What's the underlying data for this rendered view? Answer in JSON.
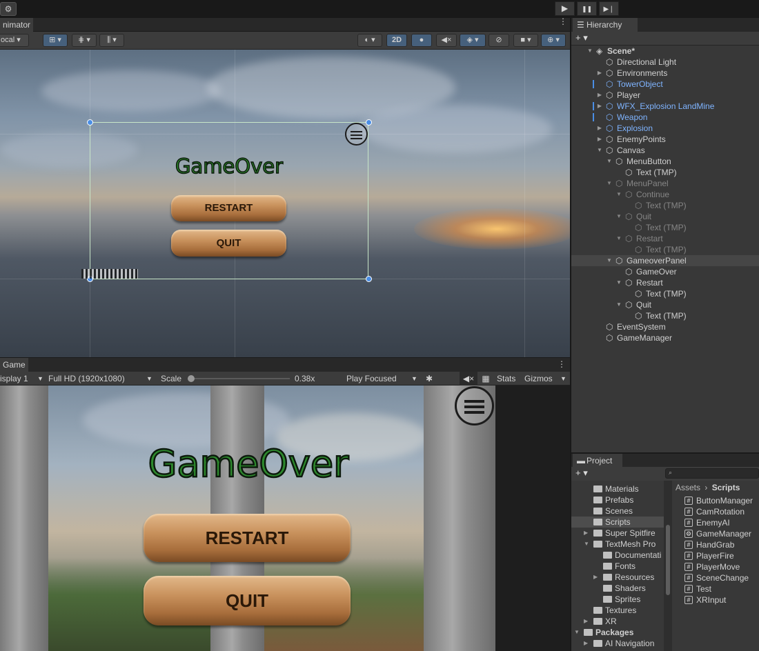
{
  "topbar": {
    "account_icon": "cloud-gear-icon",
    "play_icon": "play-icon",
    "pause_icon": "pause-icon",
    "step_icon": "step-icon",
    "play_glyph": "▶",
    "pause_glyph": "❚❚",
    "step_glyph": "▶❘"
  },
  "scene_panel": {
    "tab_label": "nimator",
    "toolbar": {
      "pivot_mode": "ocal",
      "mode_2d": "2D",
      "overflow_glyph": "⋮"
    },
    "canvas": {
      "title": "GameOver",
      "restart_label": "RESTART",
      "quit_label": "QUIT"
    }
  },
  "game_panel": {
    "tab_label": "Game",
    "overflow_glyph": "⋮",
    "toolbar": {
      "display": "isplay 1",
      "resolution": "Full HD (1920x1080)",
      "scale_label": "Scale",
      "scale_value": "0.38x",
      "scale_fraction": 0.0,
      "play_mode": "Play Focused",
      "stats_label": "Stats",
      "gizmos_label": "Gizmos"
    },
    "canvas": {
      "title": "GameOver",
      "restart_label": "RESTART",
      "quit_label": "QUIT"
    }
  },
  "hierarchy": {
    "tab_label": "Hierarchy",
    "add_glyph": "+ ▾",
    "items": [
      {
        "label": "Scene*",
        "depth": 0,
        "expanded": true,
        "type": "scene"
      },
      {
        "label": "Directional Light",
        "depth": 1,
        "type": "object"
      },
      {
        "label": "Environments",
        "depth": 1,
        "collapsed": true,
        "type": "object"
      },
      {
        "label": "TowerObject",
        "depth": 1,
        "type": "prefab",
        "modified": true
      },
      {
        "label": "Player",
        "depth": 1,
        "collapsed": true,
        "type": "object"
      },
      {
        "label": "WFX_Explosion LandMine",
        "depth": 1,
        "collapsed": true,
        "type": "prefab",
        "modified": true
      },
      {
        "label": "Weapon",
        "depth": 1,
        "type": "prefab",
        "modified": true
      },
      {
        "label": "Explosion",
        "depth": 1,
        "collapsed": true,
        "type": "prefab"
      },
      {
        "label": "EnemyPoints",
        "depth": 1,
        "collapsed": true,
        "type": "object"
      },
      {
        "label": "Canvas",
        "depth": 1,
        "expanded": true,
        "type": "object"
      },
      {
        "label": "MenuButton",
        "depth": 2,
        "expanded": true,
        "type": "object"
      },
      {
        "label": "Text (TMP)",
        "depth": 3,
        "type": "object"
      },
      {
        "label": "MenuPanel",
        "depth": 2,
        "expanded": true,
        "type": "inactive"
      },
      {
        "label": "Continue",
        "depth": 3,
        "expanded": true,
        "type": "inactive"
      },
      {
        "label": "Text (TMP)",
        "depth": 4,
        "type": "inactive"
      },
      {
        "label": "Quit",
        "depth": 3,
        "expanded": true,
        "type": "inactive"
      },
      {
        "label": "Text (TMP)",
        "depth": 4,
        "type": "inactive"
      },
      {
        "label": "Restart",
        "depth": 3,
        "expanded": true,
        "type": "inactive"
      },
      {
        "label": "Text (TMP)",
        "depth": 4,
        "type": "inactive"
      },
      {
        "label": "GameoverPanel",
        "depth": 2,
        "expanded": true,
        "type": "object",
        "selected": true
      },
      {
        "label": "GameOver",
        "depth": 3,
        "type": "object"
      },
      {
        "label": "Restart",
        "depth": 3,
        "expanded": true,
        "type": "object"
      },
      {
        "label": "Text (TMP)",
        "depth": 4,
        "type": "object"
      },
      {
        "label": "Quit",
        "depth": 3,
        "expanded": true,
        "type": "object"
      },
      {
        "label": "Text (TMP)",
        "depth": 4,
        "type": "object"
      },
      {
        "label": "EventSystem",
        "depth": 1,
        "type": "object"
      },
      {
        "label": "GameManager",
        "depth": 1,
        "type": "object"
      }
    ]
  },
  "project": {
    "tab_label": "Project",
    "add_glyph": "+ ▾",
    "breadcrumb_root": "Assets",
    "breadcrumb_sep": "›",
    "breadcrumb_current": "Scripts",
    "folders": [
      {
        "label": "Materials",
        "depth": 1
      },
      {
        "label": "Prefabs",
        "depth": 1
      },
      {
        "label": "Scenes",
        "depth": 1
      },
      {
        "label": "Scripts",
        "depth": 1,
        "selected": true
      },
      {
        "label": "Super Spitfire",
        "depth": 1,
        "collapsed": true
      },
      {
        "label": "TextMesh Pro",
        "depth": 1,
        "expanded": true
      },
      {
        "label": "Documentati",
        "depth": 2
      },
      {
        "label": "Fonts",
        "depth": 2
      },
      {
        "label": "Resources",
        "depth": 2,
        "collapsed": true
      },
      {
        "label": "Shaders",
        "depth": 2
      },
      {
        "label": "Sprites",
        "depth": 2
      },
      {
        "label": "Textures",
        "depth": 1
      },
      {
        "label": "XR",
        "depth": 1,
        "collapsed": true
      },
      {
        "label": "Packages",
        "depth": 0,
        "expanded": true,
        "bold": true
      },
      {
        "label": "AI Navigation",
        "depth": 1,
        "collapsed": true
      }
    ],
    "scripts": [
      {
        "label": "ButtonManager",
        "icon": "#"
      },
      {
        "label": "CamRotation",
        "icon": "#"
      },
      {
        "label": "EnemyAI",
        "icon": "#"
      },
      {
        "label": "GameManager",
        "icon": "⚙"
      },
      {
        "label": "HandGrab",
        "icon": "#"
      },
      {
        "label": "PlayerFire",
        "icon": "#"
      },
      {
        "label": "PlayerMove",
        "icon": "#"
      },
      {
        "label": "SceneChange",
        "icon": "#"
      },
      {
        "label": "Test",
        "icon": "#"
      },
      {
        "label": "XRInput",
        "icon": "#"
      }
    ]
  }
}
